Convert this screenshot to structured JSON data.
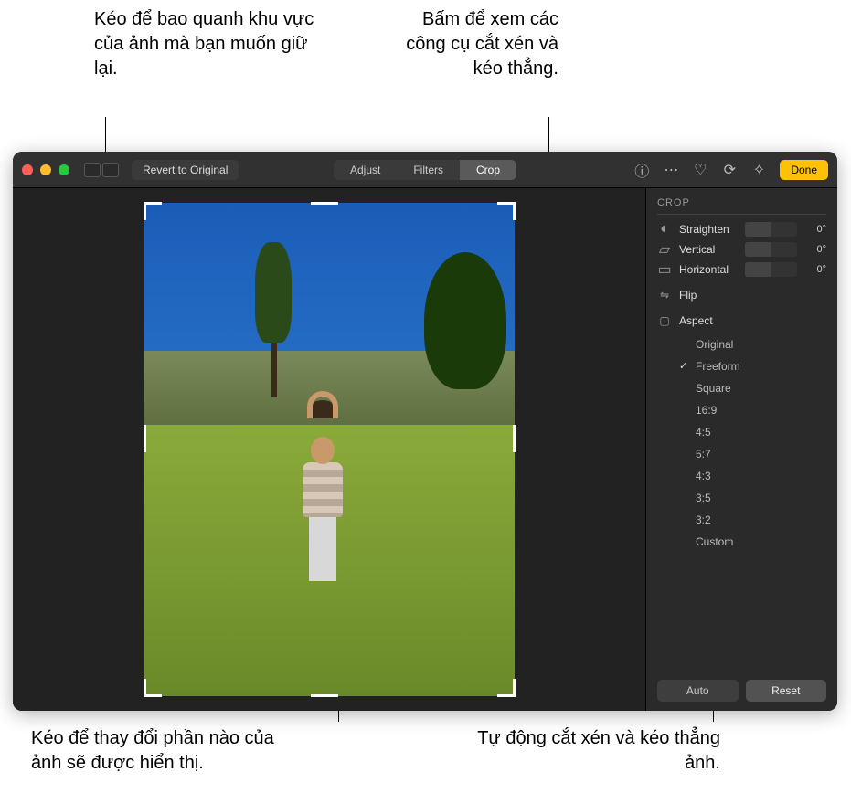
{
  "callouts": {
    "top_left": "Kéo để bao quanh khu vực của ảnh mà bạn muốn giữ lại.",
    "top_right": "Bấm để xem các công cụ cắt xén và kéo thẳng.",
    "bottom_left": "Kéo để thay đổi phần nào của ảnh sẽ được hiển thị.",
    "bottom_right": "Tự động cắt xén và kéo thẳng ảnh."
  },
  "toolbar": {
    "revert": "Revert to Original",
    "segments": {
      "adjust": "Adjust",
      "filters": "Filters",
      "crop": "Crop"
    },
    "done": "Done"
  },
  "sidebar": {
    "title": "CROP",
    "sliders": {
      "straighten": {
        "label": "Straighten",
        "value": "0°"
      },
      "vertical": {
        "label": "Vertical",
        "value": "0°"
      },
      "horizontal": {
        "label": "Horizontal",
        "value": "0°"
      }
    },
    "flip": "Flip",
    "aspect": "Aspect",
    "aspect_options": {
      "original": "Original",
      "freeform": "Freeform",
      "square": "Square",
      "r16_9": "16:9",
      "r4_5": "4:5",
      "r5_7": "5:7",
      "r4_3": "4:3",
      "r3_5": "3:5",
      "r3_2": "3:2",
      "custom": "Custom"
    },
    "auto": "Auto",
    "reset": "Reset"
  }
}
